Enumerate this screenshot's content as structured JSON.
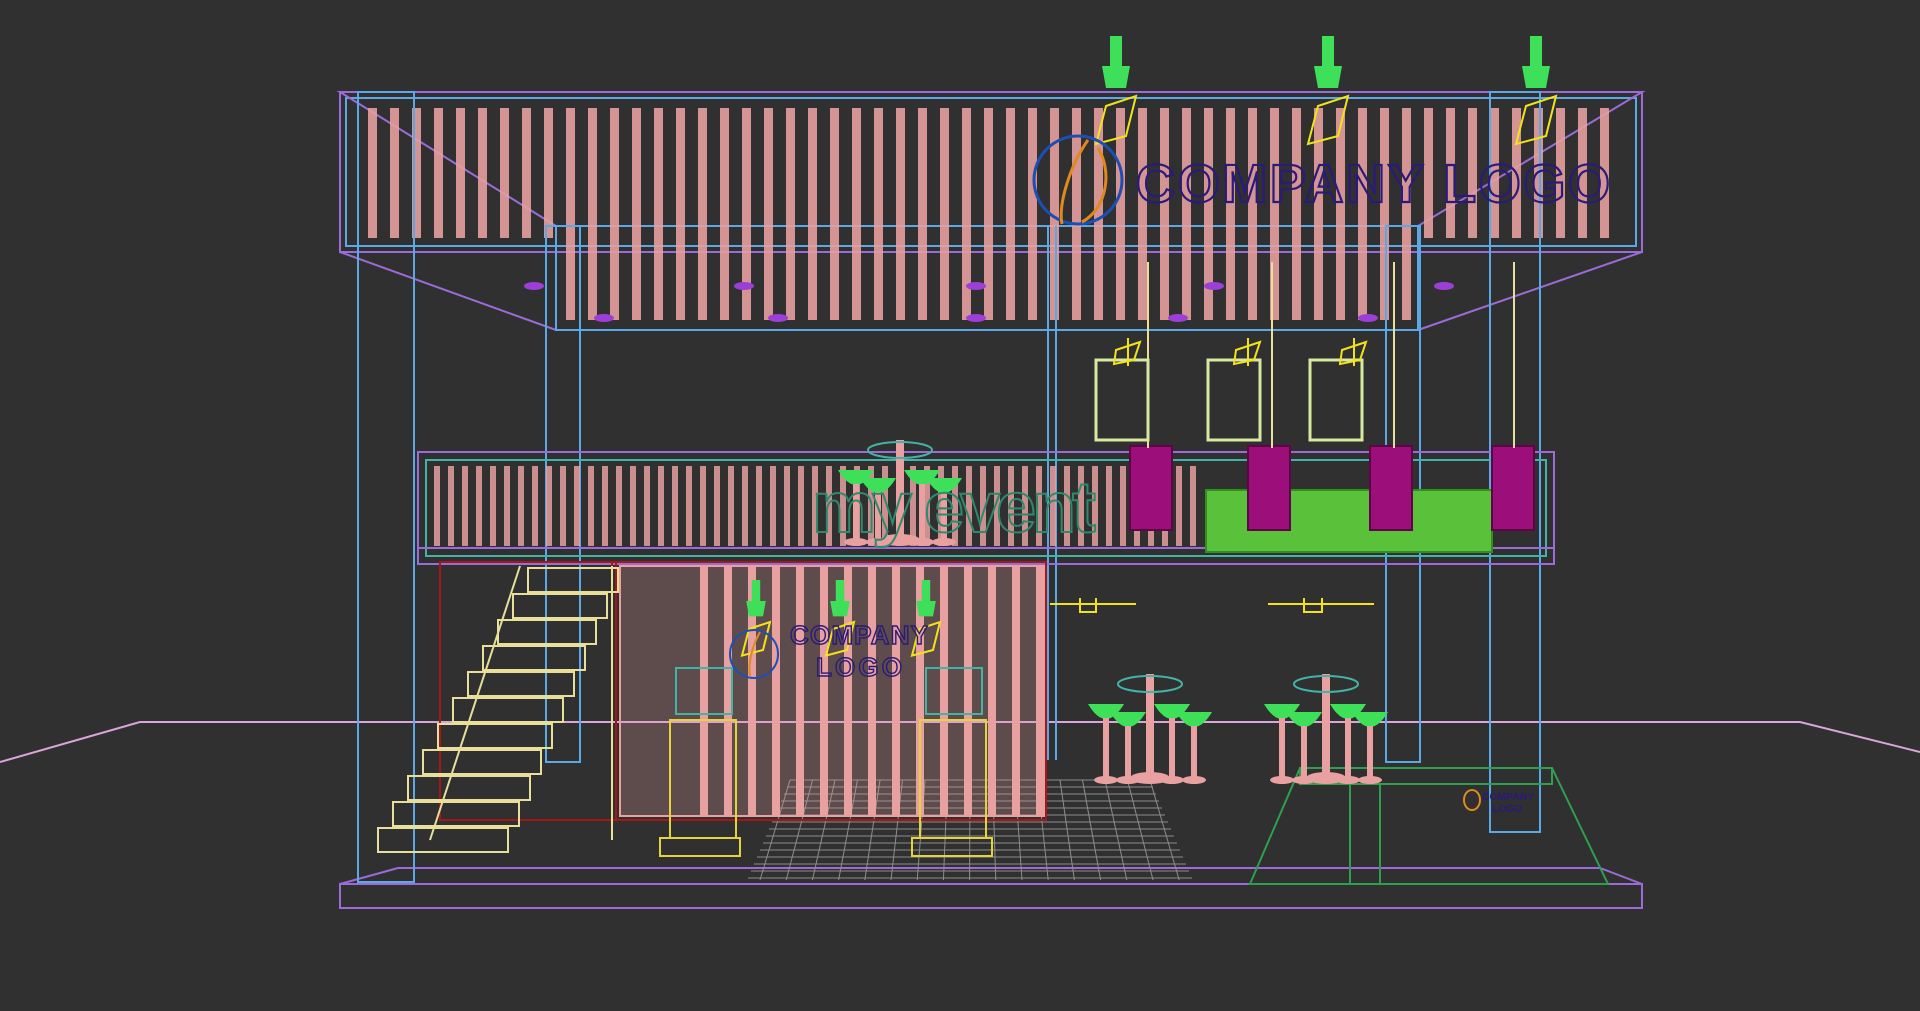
{
  "viewport": {
    "background": "#303030",
    "mode": "wireframe"
  },
  "signage": {
    "main_logo": "COMPANY LOGO",
    "event_banner": "my event",
    "small_logo_line1": "COMPANY",
    "small_logo_line2": "LOGO"
  },
  "colors": {
    "frame_violet": "#9b6bd8",
    "frame_blue": "#5aa9e6",
    "frame_teal": "#44b3a6",
    "slat_pink": "#e8a0a0",
    "stair_yellow": "#e7df9a",
    "light_green": "#3ee05a",
    "light_yellow": "#f2e21c",
    "logo_indigo": "#2a1a7a",
    "magenta": "#9c0f7a",
    "dark_red": "#a01818",
    "grid_gray": "#8d8d8d",
    "floor_line": "#d9a6d9"
  },
  "icons": [
    "spot-light-icon",
    "bar-stool-icon",
    "logo-emblem-icon"
  ]
}
